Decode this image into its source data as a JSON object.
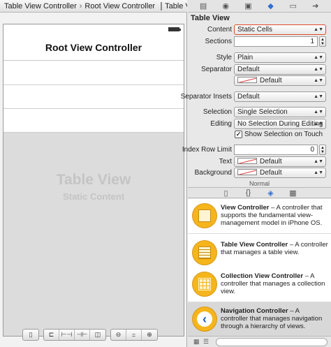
{
  "jumpbar": {
    "crumbs": [
      "Table View Controller",
      "Root View Controller",
      "Table View"
    ]
  },
  "phone": {
    "nav_title": "Root View Controller",
    "placeholder_title": "Table View",
    "placeholder_subtitle": "Static Content"
  },
  "inspector": {
    "section_title": "Table View",
    "tab_icons": [
      "file-icon",
      "quick-help-icon",
      "identity-icon",
      "attributes-icon",
      "size-icon",
      "connections-icon"
    ],
    "content": {
      "label": "Content",
      "value": "Static Cells"
    },
    "sections": {
      "label": "Sections",
      "value": "1"
    },
    "style": {
      "label": "Style",
      "value": "Plain"
    },
    "separator": {
      "label": "Separator",
      "value": "Default",
      "color_value": "Default"
    },
    "separator_insets": {
      "label": "Separator Insets",
      "value": "Default"
    },
    "selection": {
      "label": "Selection",
      "value": "Single Selection"
    },
    "editing": {
      "label": "Editing",
      "value": "No Selection During Editing"
    },
    "show_selection": {
      "label": "Show Selection on Touch",
      "checked": true
    },
    "index_row_limit": {
      "label": "Index Row Limit",
      "value": "0"
    },
    "text": {
      "label": "Text",
      "value": "Default"
    },
    "background": {
      "label": "Background",
      "value": "Default"
    },
    "normal_caption": "Normal"
  },
  "library": {
    "tab_icons": [
      "file-template-icon",
      "code-snippet-icon",
      "object-library-icon",
      "media-library-icon"
    ],
    "items": [
      {
        "name": "View Controller",
        "desc": " – A controller that supports the fundamental view-management model in iPhone OS."
      },
      {
        "name": "Table View Controller",
        "desc": " – A controller that manages a table view."
      },
      {
        "name": "Collection View Controller",
        "desc": " – A controller that manages a collection view."
      },
      {
        "name": "Navigation Controller",
        "desc": " – A controller that manages navigation through a hierarchy of views."
      }
    ]
  },
  "colors": {
    "highlight": "#e04a2a",
    "library_icon": "#f5b51b",
    "active_tab": "#2f6fd6"
  }
}
